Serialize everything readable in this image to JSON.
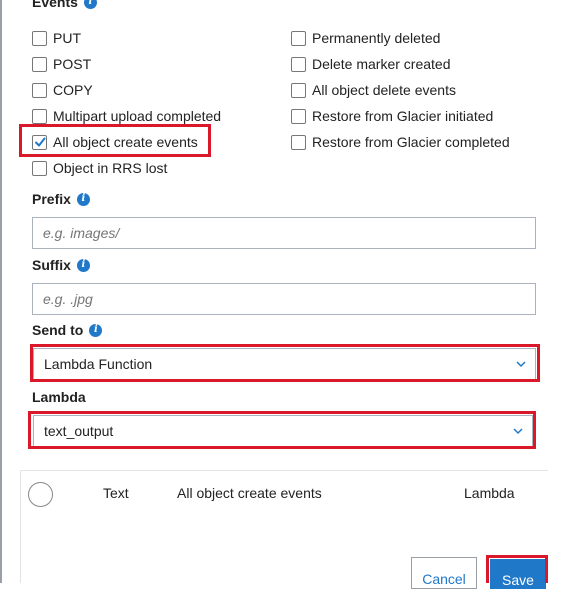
{
  "events": {
    "title": "Events",
    "left_options": [
      {
        "label": "PUT",
        "checked": false
      },
      {
        "label": "POST",
        "checked": false
      },
      {
        "label": "COPY",
        "checked": false
      },
      {
        "label": "Multipart upload completed",
        "checked": false
      },
      {
        "label": "All object create events",
        "checked": true
      },
      {
        "label": "Object in RRS lost",
        "checked": false
      }
    ],
    "right_options": [
      {
        "label": "Permanently deleted",
        "checked": false
      },
      {
        "label": "Delete marker created",
        "checked": false
      },
      {
        "label": "All object delete events",
        "checked": false
      },
      {
        "label": "Restore from Glacier initiated",
        "checked": false
      },
      {
        "label": "Restore from Glacier completed",
        "checked": false
      }
    ]
  },
  "prefix": {
    "label": "Prefix",
    "placeholder": "e.g. images/",
    "value": ""
  },
  "suffix": {
    "label": "Suffix",
    "placeholder": "e.g. .jpg",
    "value": ""
  },
  "send_to": {
    "label": "Send to",
    "selected": "Lambda Function"
  },
  "lambda": {
    "label": "Lambda",
    "selected": "text_output"
  },
  "table_row": {
    "col1": "Text",
    "col2": "All object create events",
    "col3": "Lambda"
  },
  "buttons": {
    "cancel": "Cancel",
    "save": "Save"
  },
  "colors": {
    "accent": "#1f78c8",
    "highlight": "#d9182a"
  }
}
